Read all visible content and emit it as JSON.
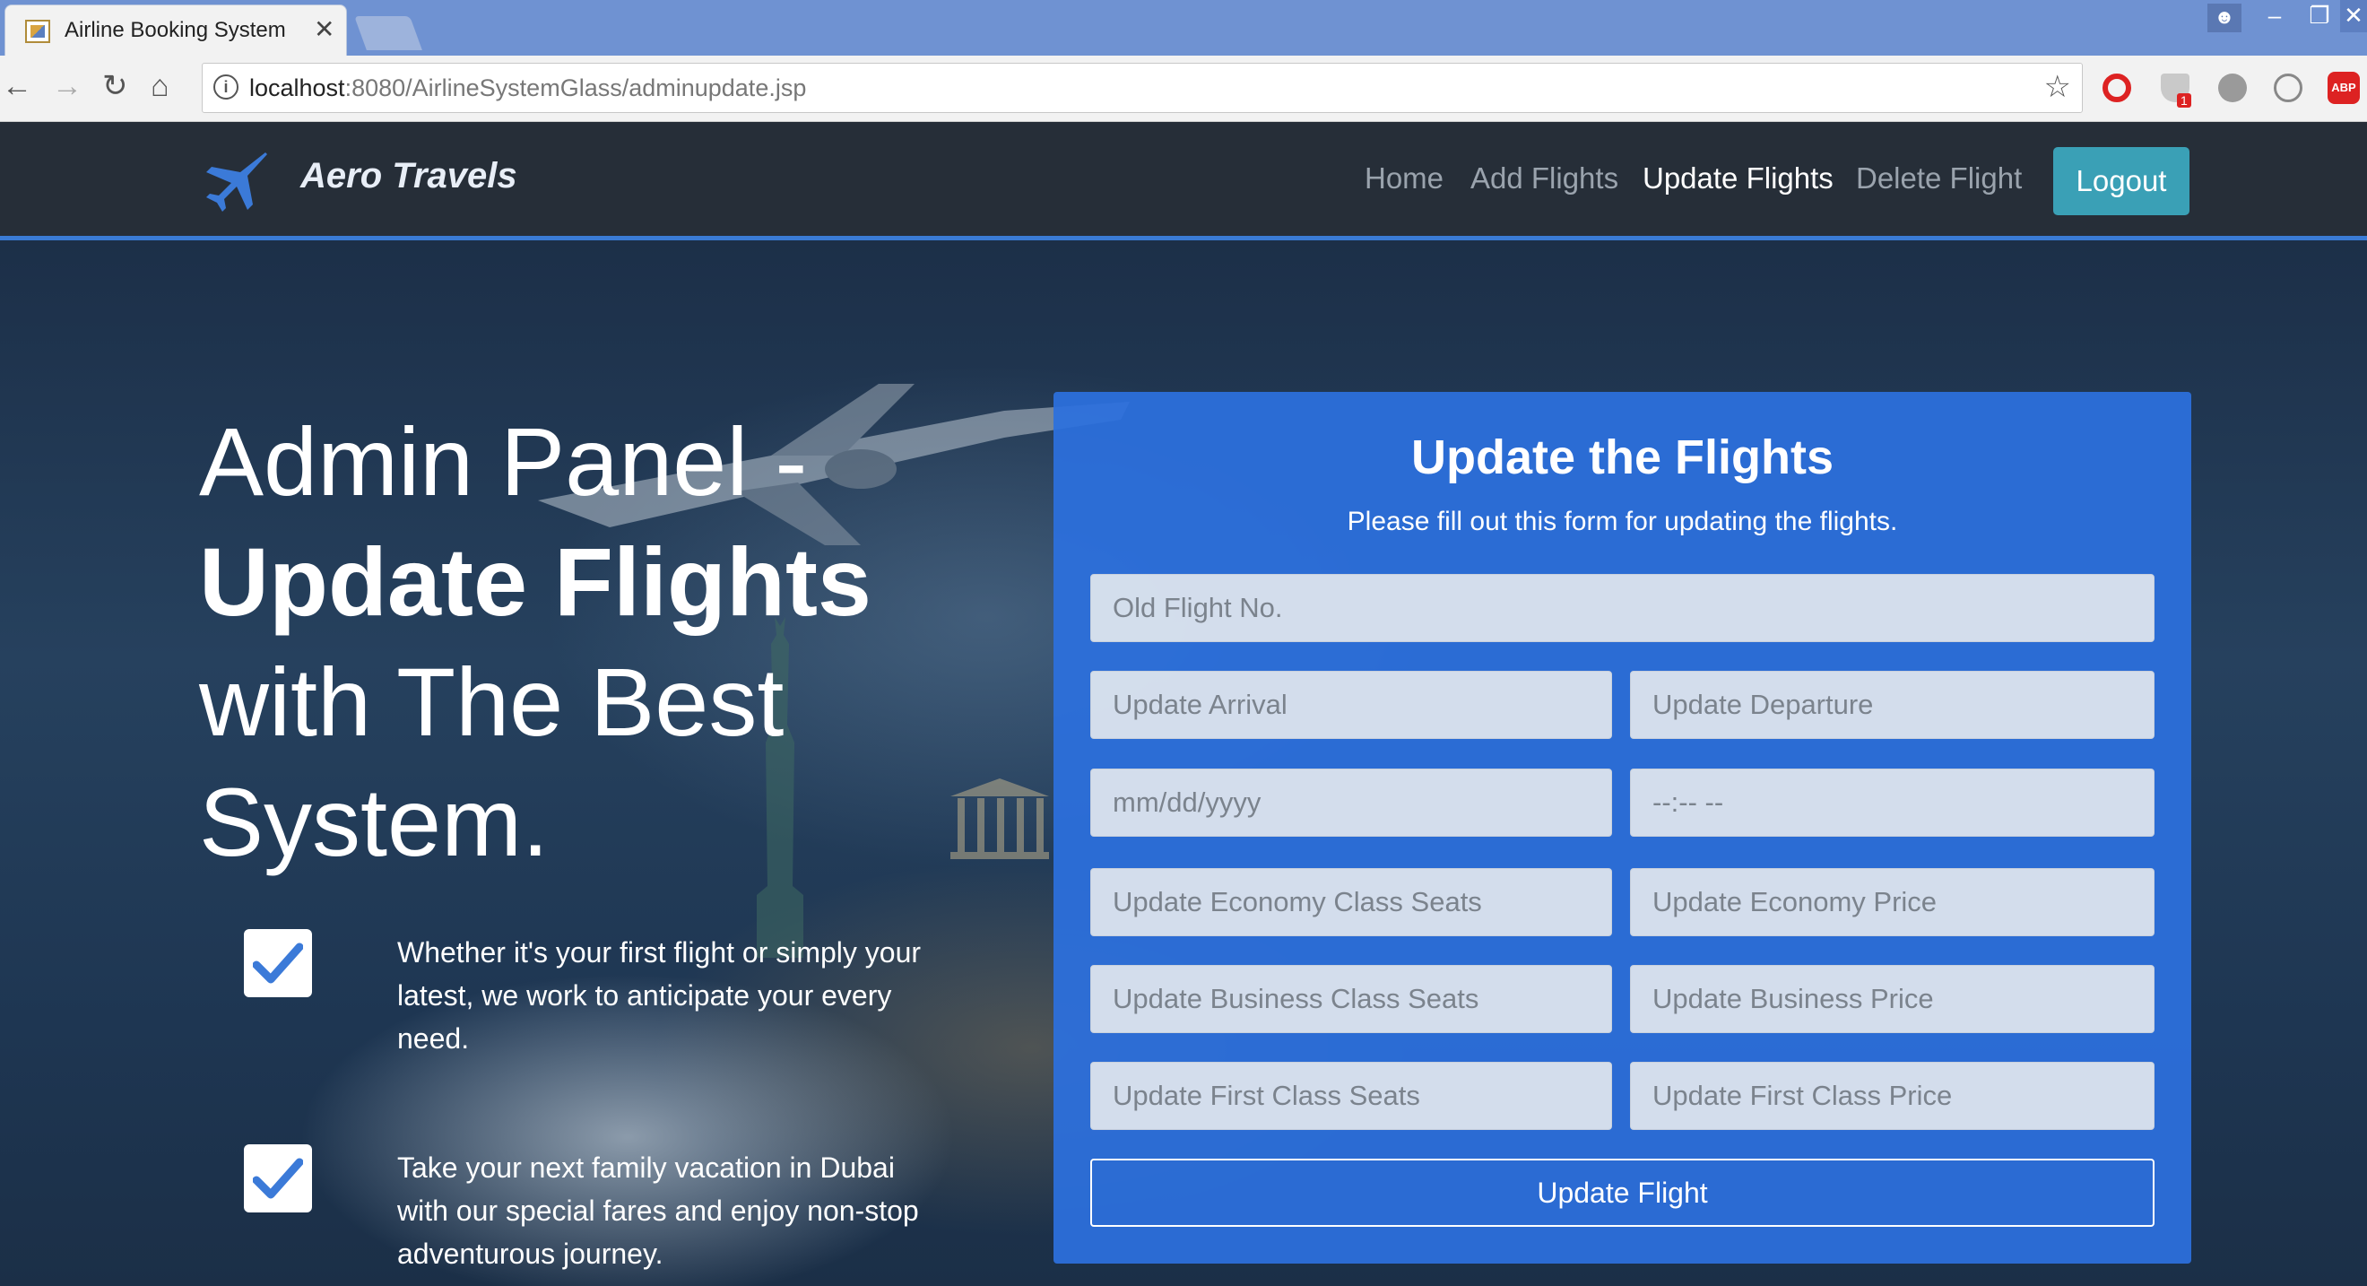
{
  "browser": {
    "tab_title": "Airline Booking System",
    "tab_close": "✕",
    "url_host": "localhost",
    "url_rest": ":8080/AirlineSystemGlass/adminupdate.jsp",
    "ext_badge": "1",
    "ext_abp": "ABP"
  },
  "navbar": {
    "brand": "Aero Travels",
    "links": [
      "Home",
      "Add Flights",
      "Update Flights",
      "Delete Flight"
    ],
    "active": "Update Flights",
    "logout": "Logout"
  },
  "hero": {
    "line1": "Admin Panel -",
    "line2": "Update Flights",
    "line3": "with The Best",
    "line4": "System.",
    "features": [
      "Whether it's your first flight or simply your latest, we work to anticipate your every need.",
      "Take your next family vacation in Dubai with our special fares and enjoy non-stop adventurous journey."
    ]
  },
  "form": {
    "title": "Update the Flights",
    "subtitle": "Please fill out this form for updating the flights.",
    "old_flight_placeholder": "Old Flight No.",
    "arrival_placeholder": "Update Arrival",
    "departure_placeholder": "Update Departure",
    "date_placeholder": "mm/dd/yyyy",
    "time_placeholder": "--:-- --",
    "economy_seats_placeholder": "Update Economy Class Seats",
    "economy_price_placeholder": "Update Economy Price",
    "business_seats_placeholder": "Update Business Class Seats",
    "business_price_placeholder": "Update Business Price",
    "first_seats_placeholder": "Update First Class Seats",
    "first_price_placeholder": "Update First Class Price",
    "submit": "Update Flight"
  },
  "colors": {
    "navbar_bg": "#262e38",
    "accent_line": "#3a7bd5",
    "logout_bg": "#3aa0b6",
    "panel_bg": "#2c70de"
  },
  "icons": {
    "brand": "airplane-icon",
    "feature": "checkmark-icon"
  }
}
